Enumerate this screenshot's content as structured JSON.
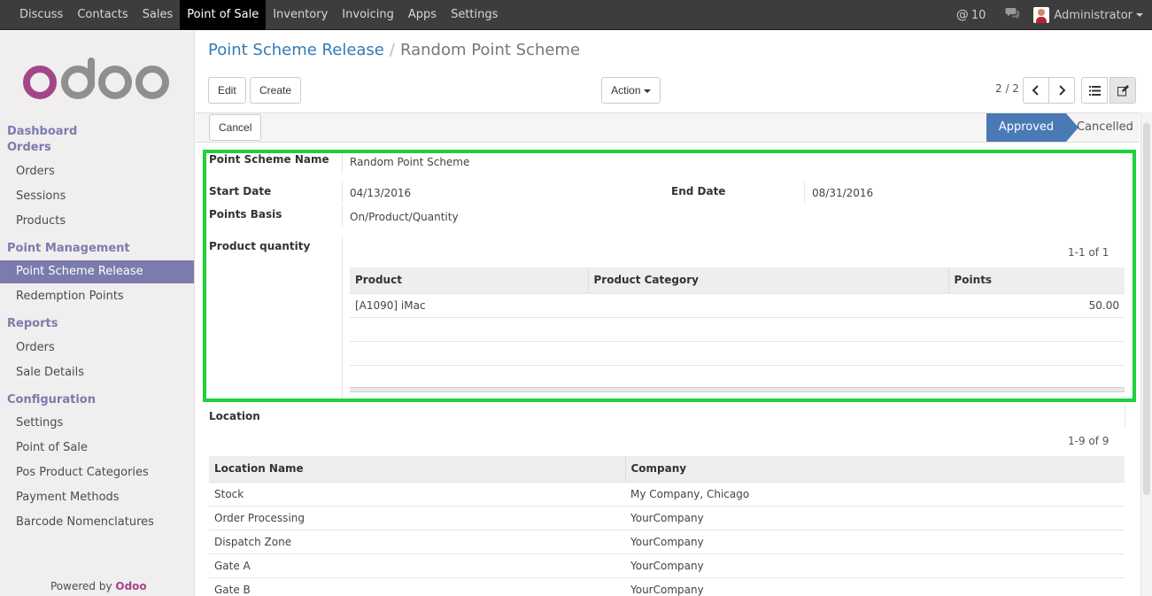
{
  "topnav": {
    "items": [
      "Discuss",
      "Contacts",
      "Sales",
      "Point of Sale",
      "Inventory",
      "Invoicing",
      "Apps",
      "Settings"
    ],
    "active_index": 3,
    "notif_count": "10",
    "user": "Administrator"
  },
  "sidebar": {
    "sections": [
      {
        "title": "Dashboard"
      },
      {
        "title": "Orders",
        "items": [
          "Orders",
          "Sessions",
          "Products"
        ]
      },
      {
        "title": "Point Management",
        "items": [
          "Point Scheme Release",
          "Redemption Points"
        ]
      },
      {
        "title": "Reports",
        "items": [
          "Orders",
          "Sale Details"
        ]
      },
      {
        "title": "Configuration",
        "items": [
          "Settings",
          "Point of Sale",
          "Pos Product Categories",
          "Payment Methods",
          "Barcode Nomenclatures"
        ]
      }
    ],
    "powered_by": "Powered by",
    "brand": "Odoo"
  },
  "breadcrumb": {
    "parent": "Point Scheme Release",
    "current": "Random Point Scheme"
  },
  "toolbar": {
    "edit": "Edit",
    "create": "Create",
    "action": "Action",
    "pager": "2 / 2",
    "cancel": "Cancel"
  },
  "status": {
    "approved": "Approved",
    "cancelled": "Cancelled"
  },
  "form": {
    "name_label": "Point Scheme Name",
    "name_value": "Random Point Scheme",
    "start_label": "Start Date",
    "start_value": "04/13/2016",
    "end_label": "End Date",
    "end_value": "08/31/2016",
    "basis_label": "Points Basis",
    "basis_value": "On/Product/Quantity",
    "pq_label": "Product quantity",
    "pq_count": "1-1 of 1",
    "pq_headers": [
      "Product",
      "Product Category",
      "Points"
    ],
    "pq_rows": [
      [
        "[A1090] iMac",
        "",
        "50.00"
      ]
    ],
    "loc_label": "Location",
    "loc_count": "1-9 of 9",
    "loc_headers": [
      "Location Name",
      "Company"
    ],
    "loc_rows": [
      [
        "Stock",
        "My Company, Chicago"
      ],
      [
        "Order Processing",
        "YourCompany"
      ],
      [
        "Dispatch Zone",
        "YourCompany"
      ],
      [
        "Gate A",
        "YourCompany"
      ],
      [
        "Gate B",
        "YourCompany"
      ]
    ]
  },
  "colors": {
    "accent": "#7c7bad",
    "highlight": "#1fd13b",
    "status": "#4a7ab5",
    "brand": "#a24689"
  }
}
